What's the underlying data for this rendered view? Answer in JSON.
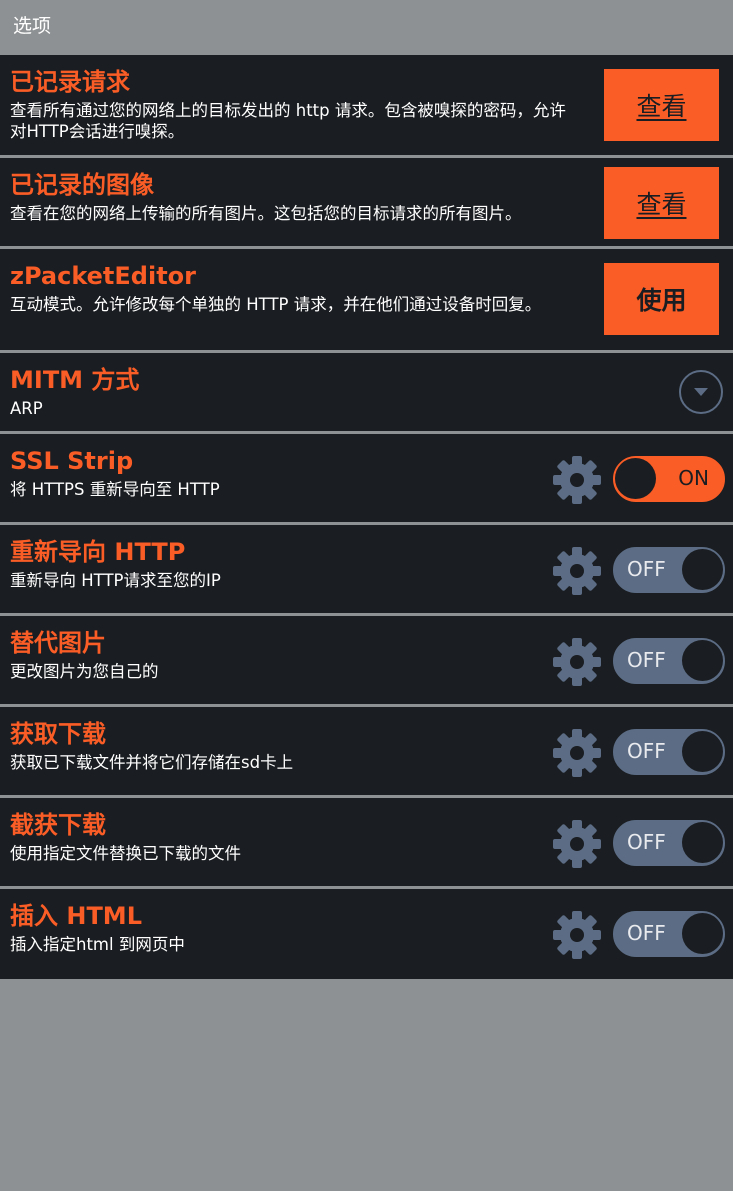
{
  "titlebar": {
    "title": "选项"
  },
  "colors": {
    "accent": "#fa5d26",
    "toggle_off": "#5b6c84",
    "panel": "#1a1d21",
    "background": "#8e9193"
  },
  "rows": [
    {
      "title": "已记录请求",
      "desc": "查看所有通过您的网络上的目标发出的 http 请求。包含被嗅探的密码，允许对HTTP会话进行嗅探。",
      "button": "查看"
    },
    {
      "title": "已记录的图像",
      "desc": "查看在您的网络上传输的所有图片。这包括您的目标请求的所有图片。",
      "button": "查看"
    },
    {
      "title": "zPacketEditor",
      "desc": "互动模式。允许修改每个单独的 HTTP 请求，并在他们通过设备时回复。",
      "button": "使用"
    },
    {
      "title": "MITM 方式",
      "value": "ARP",
      "icon": "dropdown-chevron-icon"
    },
    {
      "title": "SSL Strip",
      "desc": "将 HTTPS 重新导向至 HTTP",
      "toggle": "ON",
      "icon": "gear-icon"
    },
    {
      "title": "重新导向 HTTP",
      "desc": "重新导向 HTTP请求至您的IP",
      "toggle": "OFF",
      "icon": "gear-icon"
    },
    {
      "title": "替代图片",
      "desc": "更改图片为您自己的",
      "toggle": "OFF",
      "icon": "gear-icon"
    },
    {
      "title": "获取下载",
      "desc": "获取已下载文件并将它们存储在sd卡上",
      "toggle": "OFF",
      "icon": "gear-icon"
    },
    {
      "title": "截获下载",
      "desc": "使用指定文件替换已下载的文件",
      "toggle": "OFF",
      "icon": "gear-icon"
    },
    {
      "title": "插入 HTML",
      "desc": "插入指定html 到网页中",
      "toggle": "OFF",
      "icon": "gear-icon"
    }
  ]
}
